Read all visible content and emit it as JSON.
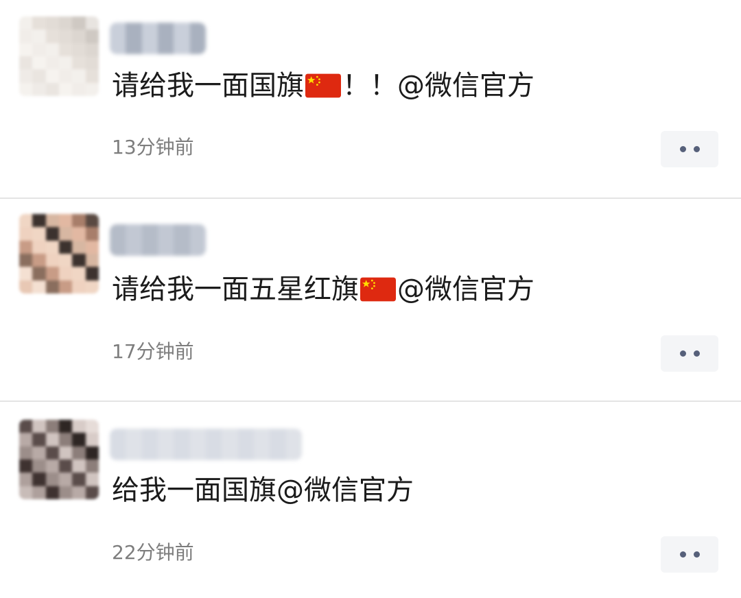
{
  "comments": [
    {
      "text_before": "请给我一面国旗",
      "flag_icon": "china-flag-emoji",
      "text_after": "！！@微信官方",
      "time": "13分钟前",
      "more_icon": "more-dots-icon"
    },
    {
      "text_before": "请给我一面五星红旗",
      "flag_icon": "china-flag-emoji",
      "text_after": " @微信官方",
      "time": "17分钟前",
      "more_icon": "more-dots-icon"
    },
    {
      "text_before": "给我一面国旗@微信官方",
      "flag_icon": "",
      "text_after": "",
      "time": "22分钟前",
      "more_icon": "more-dots-icon"
    }
  ],
  "colors": {
    "comment_text": "#1b1b1b",
    "timestamp": "#7d7d7d",
    "more_button_bg": "#f4f5f7",
    "more_dots": "#56607a",
    "divider": "#e4e4e4",
    "flag_red": "#de2910",
    "flag_yellow": "#ffde00"
  }
}
